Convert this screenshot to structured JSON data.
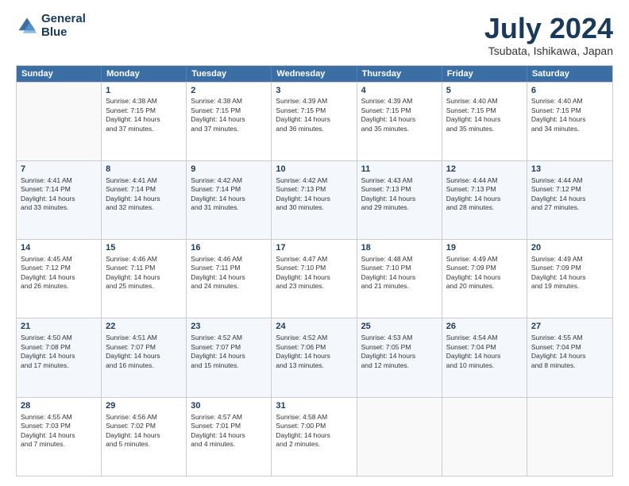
{
  "logo": {
    "line1": "General",
    "line2": "Blue"
  },
  "title": "July 2024",
  "subtitle": "Tsubata, Ishikawa, Japan",
  "header_days": [
    "Sunday",
    "Monday",
    "Tuesday",
    "Wednesday",
    "Thursday",
    "Friday",
    "Saturday"
  ],
  "rows": [
    [
      {
        "day": "",
        "sunrise": "",
        "sunset": "",
        "daylight": ""
      },
      {
        "day": "1",
        "sunrise": "Sunrise: 4:38 AM",
        "sunset": "Sunset: 7:15 PM",
        "daylight": "Daylight: 14 hours and 37 minutes."
      },
      {
        "day": "2",
        "sunrise": "Sunrise: 4:38 AM",
        "sunset": "Sunset: 7:15 PM",
        "daylight": "Daylight: 14 hours and 37 minutes."
      },
      {
        "day": "3",
        "sunrise": "Sunrise: 4:39 AM",
        "sunset": "Sunset: 7:15 PM",
        "daylight": "Daylight: 14 hours and 36 minutes."
      },
      {
        "day": "4",
        "sunrise": "Sunrise: 4:39 AM",
        "sunset": "Sunset: 7:15 PM",
        "daylight": "Daylight: 14 hours and 35 minutes."
      },
      {
        "day": "5",
        "sunrise": "Sunrise: 4:40 AM",
        "sunset": "Sunset: 7:15 PM",
        "daylight": "Daylight: 14 hours and 35 minutes."
      },
      {
        "day": "6",
        "sunrise": "Sunrise: 4:40 AM",
        "sunset": "Sunset: 7:15 PM",
        "daylight": "Daylight: 14 hours and 34 minutes."
      }
    ],
    [
      {
        "day": "7",
        "sunrise": "Sunrise: 4:41 AM",
        "sunset": "Sunset: 7:14 PM",
        "daylight": "Daylight: 14 hours and 33 minutes."
      },
      {
        "day": "8",
        "sunrise": "Sunrise: 4:41 AM",
        "sunset": "Sunset: 7:14 PM",
        "daylight": "Daylight: 14 hours and 32 minutes."
      },
      {
        "day": "9",
        "sunrise": "Sunrise: 4:42 AM",
        "sunset": "Sunset: 7:14 PM",
        "daylight": "Daylight: 14 hours and 31 minutes."
      },
      {
        "day": "10",
        "sunrise": "Sunrise: 4:42 AM",
        "sunset": "Sunset: 7:13 PM",
        "daylight": "Daylight: 14 hours and 30 minutes."
      },
      {
        "day": "11",
        "sunrise": "Sunrise: 4:43 AM",
        "sunset": "Sunset: 7:13 PM",
        "daylight": "Daylight: 14 hours and 29 minutes."
      },
      {
        "day": "12",
        "sunrise": "Sunrise: 4:44 AM",
        "sunset": "Sunset: 7:13 PM",
        "daylight": "Daylight: 14 hours and 28 minutes."
      },
      {
        "day": "13",
        "sunrise": "Sunrise: 4:44 AM",
        "sunset": "Sunset: 7:12 PM",
        "daylight": "Daylight: 14 hours and 27 minutes."
      }
    ],
    [
      {
        "day": "14",
        "sunrise": "Sunrise: 4:45 AM",
        "sunset": "Sunset: 7:12 PM",
        "daylight": "Daylight: 14 hours and 26 minutes."
      },
      {
        "day": "15",
        "sunrise": "Sunrise: 4:46 AM",
        "sunset": "Sunset: 7:11 PM",
        "daylight": "Daylight: 14 hours and 25 minutes."
      },
      {
        "day": "16",
        "sunrise": "Sunrise: 4:46 AM",
        "sunset": "Sunset: 7:11 PM",
        "daylight": "Daylight: 14 hours and 24 minutes."
      },
      {
        "day": "17",
        "sunrise": "Sunrise: 4:47 AM",
        "sunset": "Sunset: 7:10 PM",
        "daylight": "Daylight: 14 hours and 23 minutes."
      },
      {
        "day": "18",
        "sunrise": "Sunrise: 4:48 AM",
        "sunset": "Sunset: 7:10 PM",
        "daylight": "Daylight: 14 hours and 21 minutes."
      },
      {
        "day": "19",
        "sunrise": "Sunrise: 4:49 AM",
        "sunset": "Sunset: 7:09 PM",
        "daylight": "Daylight: 14 hours and 20 minutes."
      },
      {
        "day": "20",
        "sunrise": "Sunrise: 4:49 AM",
        "sunset": "Sunset: 7:09 PM",
        "daylight": "Daylight: 14 hours and 19 minutes."
      }
    ],
    [
      {
        "day": "21",
        "sunrise": "Sunrise: 4:50 AM",
        "sunset": "Sunset: 7:08 PM",
        "daylight": "Daylight: 14 hours and 17 minutes."
      },
      {
        "day": "22",
        "sunrise": "Sunrise: 4:51 AM",
        "sunset": "Sunset: 7:07 PM",
        "daylight": "Daylight: 14 hours and 16 minutes."
      },
      {
        "day": "23",
        "sunrise": "Sunrise: 4:52 AM",
        "sunset": "Sunset: 7:07 PM",
        "daylight": "Daylight: 14 hours and 15 minutes."
      },
      {
        "day": "24",
        "sunrise": "Sunrise: 4:52 AM",
        "sunset": "Sunset: 7:06 PM",
        "daylight": "Daylight: 14 hours and 13 minutes."
      },
      {
        "day": "25",
        "sunrise": "Sunrise: 4:53 AM",
        "sunset": "Sunset: 7:05 PM",
        "daylight": "Daylight: 14 hours and 12 minutes."
      },
      {
        "day": "26",
        "sunrise": "Sunrise: 4:54 AM",
        "sunset": "Sunset: 7:04 PM",
        "daylight": "Daylight: 14 hours and 10 minutes."
      },
      {
        "day": "27",
        "sunrise": "Sunrise: 4:55 AM",
        "sunset": "Sunset: 7:04 PM",
        "daylight": "Daylight: 14 hours and 8 minutes."
      }
    ],
    [
      {
        "day": "28",
        "sunrise": "Sunrise: 4:55 AM",
        "sunset": "Sunset: 7:03 PM",
        "daylight": "Daylight: 14 hours and 7 minutes."
      },
      {
        "day": "29",
        "sunrise": "Sunrise: 4:56 AM",
        "sunset": "Sunset: 7:02 PM",
        "daylight": "Daylight: 14 hours and 5 minutes."
      },
      {
        "day": "30",
        "sunrise": "Sunrise: 4:57 AM",
        "sunset": "Sunset: 7:01 PM",
        "daylight": "Daylight: 14 hours and 4 minutes."
      },
      {
        "day": "31",
        "sunrise": "Sunrise: 4:58 AM",
        "sunset": "Sunset: 7:00 PM",
        "daylight": "Daylight: 14 hours and 2 minutes."
      },
      {
        "day": "",
        "sunrise": "",
        "sunset": "",
        "daylight": ""
      },
      {
        "day": "",
        "sunrise": "",
        "sunset": "",
        "daylight": ""
      },
      {
        "day": "",
        "sunrise": "",
        "sunset": "",
        "daylight": ""
      }
    ]
  ]
}
